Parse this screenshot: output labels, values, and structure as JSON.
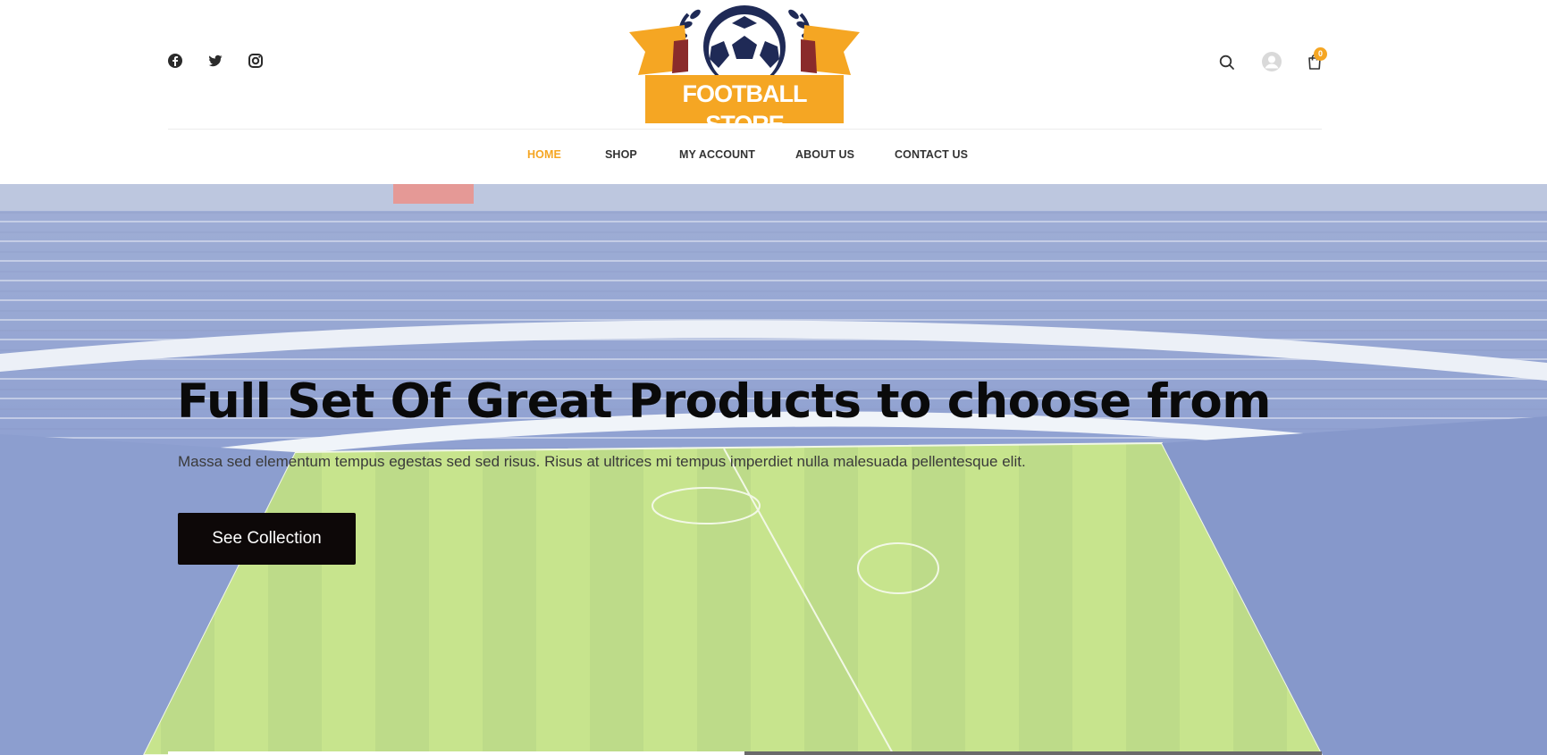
{
  "header": {
    "social": [
      {
        "name": "facebook-icon"
      },
      {
        "name": "twitter-icon"
      },
      {
        "name": "instagram-icon"
      }
    ],
    "logo": {
      "text": "FOOTBALL STORE"
    },
    "icons": {
      "search": "search-icon",
      "account": "user-avatar-icon",
      "cart": "shopping-bag-icon"
    },
    "cart_count": "0"
  },
  "nav": {
    "items": [
      {
        "label": "HOME",
        "active": true
      },
      {
        "label": "SHOP"
      },
      {
        "label": "MY ACCOUNT"
      },
      {
        "label": "ABOUT US"
      },
      {
        "label": "CONTACT US"
      }
    ]
  },
  "hero": {
    "title": "Full Set Of Great Products to choose from",
    "subtitle": "Massa sed elementum tempus egestas sed sed risus. Risus at ultrices mi tempus imperdiet nulla malesuada pellentesque elit.",
    "button_label": "See Collection"
  },
  "colors": {
    "accent": "#f5a623",
    "logo_navy": "#1f2a56",
    "button_bg": "#0d0808"
  }
}
